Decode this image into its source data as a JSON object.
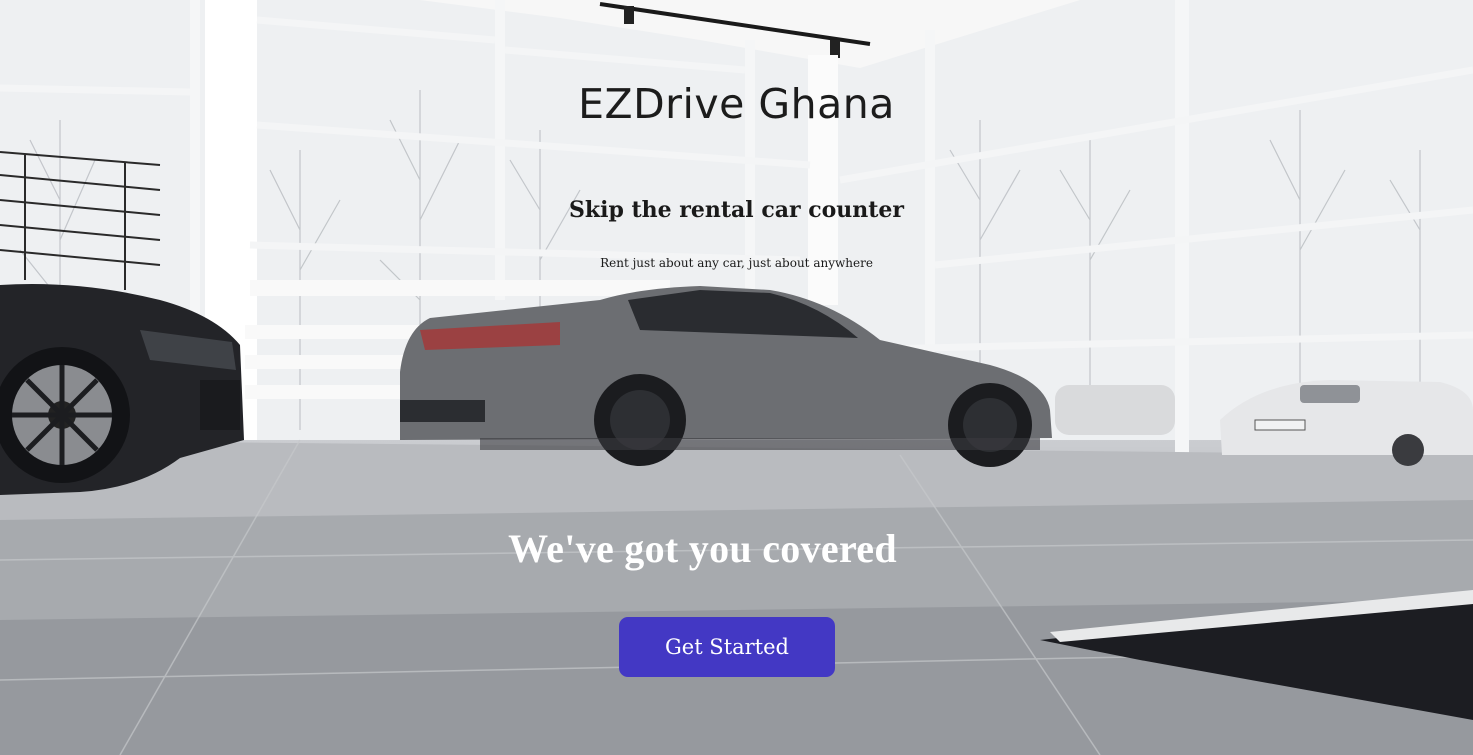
{
  "hero": {
    "brand": "EZDrive Ghana",
    "tagline": "Skip the rental car counter",
    "subtagline": "Rent just about any car, just about anywhere",
    "headline": "We've got you covered",
    "cta_label": "Get Started"
  },
  "colors": {
    "cta_background": "#4338c4",
    "cta_text": "#ffffff",
    "headline_text": "#ffffff",
    "brand_text": "#1c1c1c"
  }
}
